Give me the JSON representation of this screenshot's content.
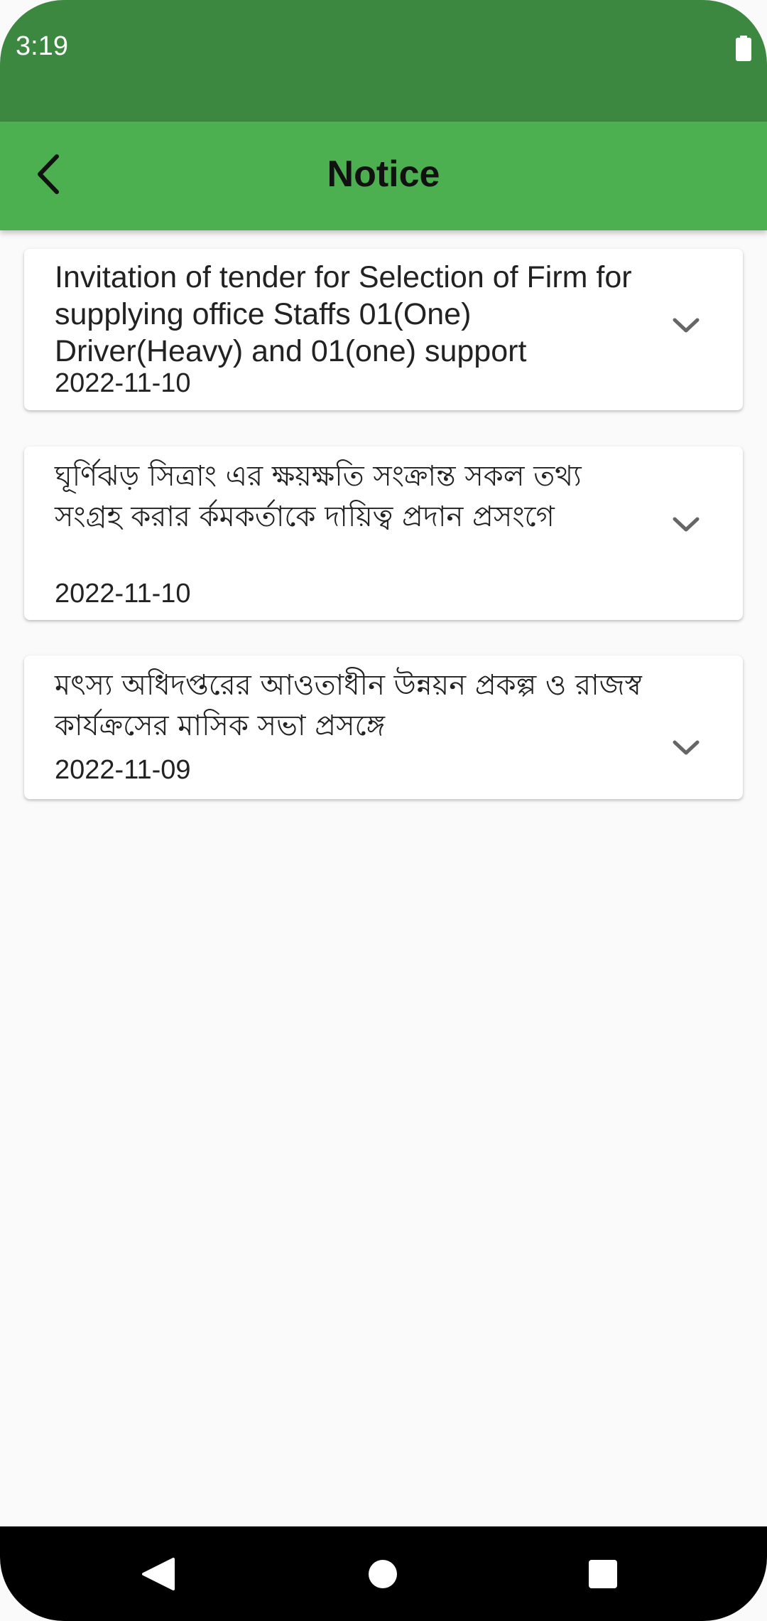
{
  "status_bar": {
    "time": "3:19",
    "battery_icon": "battery-full-icon",
    "color": "#3d8840"
  },
  "app_bar": {
    "title": "Notice",
    "back_icon": "chevron-left-icon",
    "color": "#4caf50"
  },
  "notices": [
    {
      "title": "Invitation of tender for Selection of Firm for supplying office Staffs 01(One) Driver(Heavy) and 01(one) support",
      "date": "2022-11-10",
      "expand_icon": "chevron-down-icon"
    },
    {
      "title": "ঘূর্ণিঝড় সিত্রাং এর ক্ষয়ক্ষতি সংক্রান্ত সকল তথ্য সংগ্রহ করার র্কমকর্তাকে দায়িত্ব প্রদান প্রসংগে",
      "date": "2022-11-10",
      "expand_icon": "chevron-down-icon"
    },
    {
      "title": "মৎস্য অধিদপ্তরের আওতাধীন উন্নয়ন প্রকল্প ও রাজস্ব কার্যক্রসের মাসিক সভা প্রসঙ্গে",
      "date": "2022-11-09",
      "expand_icon": "chevron-down-icon"
    }
  ],
  "nav_bar": {
    "back_icon": "triangle-back-icon",
    "home_icon": "circle-home-icon",
    "recents_icon": "square-recents-icon"
  }
}
